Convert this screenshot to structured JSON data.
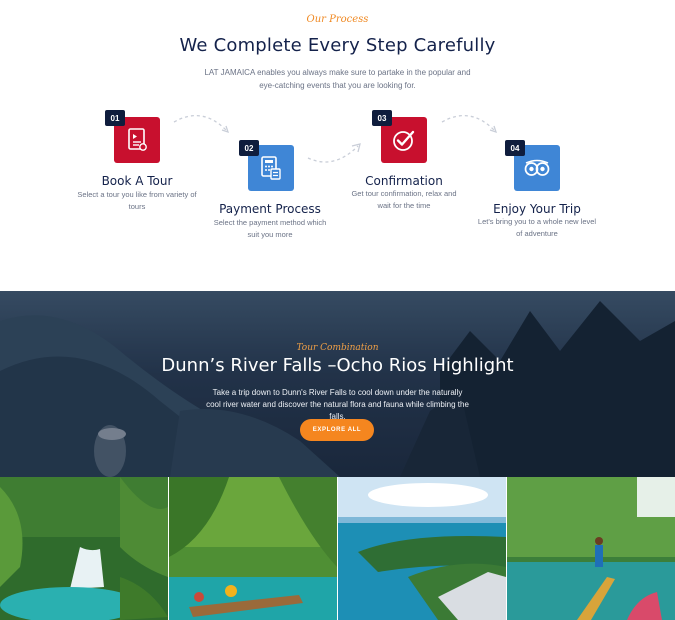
{
  "process": {
    "eyebrow": "Our Process",
    "heading": "We Complete Every Step Carefully",
    "intro": "LAT JAMAICA enables you always make sure to partake in the popular and eye-catching events that you are looking for.",
    "steps": [
      {
        "num": "01",
        "title": "Book A Tour",
        "desc": "Select a tour you like from variety of tours",
        "icon": "document-icon"
      },
      {
        "num": "02",
        "title": "Payment Process",
        "desc": "Select the payment method which suit you more",
        "icon": "calculator-icon"
      },
      {
        "num": "03",
        "title": "Confirmation",
        "desc": "Get tour confirmation, relax and wait for the time",
        "icon": "check-badge-icon"
      },
      {
        "num": "04",
        "title": "Enjoy Your Trip",
        "desc": "Let's bring you to a whole new level of adventure",
        "icon": "owl-eyes-icon"
      }
    ]
  },
  "banner": {
    "eyebrow": "Tour Combination",
    "title": "Dunn’s River Falls –Ocho Rios Highlight",
    "text": "Take a trip down to Dunn's River Falls to cool down under the naturally cool river water and discover the natural flora and fauna while climbing the falls.",
    "button": "EXPLORE ALL"
  },
  "colors": {
    "accent_orange": "#f5861f",
    "red": "#c8102e",
    "blue": "#3f86d6",
    "navy": "#14224b"
  }
}
